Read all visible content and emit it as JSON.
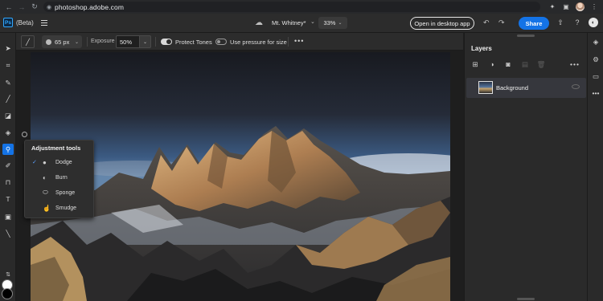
{
  "browser": {
    "url": "photoshop.adobe.com",
    "nav_icons": [
      "back-icon",
      "forward-icon",
      "reload-icon"
    ],
    "right_icons": [
      "extensions-icon",
      "sidebar-icon",
      "profile-avatar",
      "more-icon"
    ]
  },
  "header": {
    "logo": "Ps",
    "beta_label": "(Beta)",
    "doc_title": "Mt. Whitney*",
    "zoom": "33%",
    "open_desktop_label": "Open in desktop app",
    "share_label": "Share"
  },
  "tools": [
    {
      "name": "move-tool",
      "glyph": "➤",
      "active": false
    },
    {
      "name": "lasso-tool",
      "glyph": "⌗",
      "active": false
    },
    {
      "name": "quick-select-tool",
      "glyph": "✎",
      "active": false
    },
    {
      "name": "brush-tool",
      "glyph": "╱",
      "active": false
    },
    {
      "name": "eraser-tool",
      "glyph": "◪",
      "active": false
    },
    {
      "name": "paint-bucket-tool",
      "glyph": "◈",
      "active": false
    },
    {
      "name": "dodge-tool",
      "glyph": "⚲",
      "active": true
    },
    {
      "name": "healing-brush-tool",
      "glyph": "✐",
      "active": false
    },
    {
      "name": "crop-tool",
      "glyph": "⊓",
      "active": false
    },
    {
      "name": "type-tool",
      "glyph": "T",
      "active": false
    },
    {
      "name": "image-tool",
      "glyph": "▣",
      "active": false
    },
    {
      "name": "eyedropper-tool",
      "glyph": "╲",
      "active": false
    }
  ],
  "options": {
    "brush_size": "65 px",
    "exposure_label": "Exposure",
    "exposure_value": "50%",
    "protect_tones_label": "Protect Tones",
    "protect_tones_on": true,
    "pressure_label": "Use pressure for size",
    "pressure_on": false
  },
  "flyout": {
    "title": "Adjustment tools",
    "items": [
      {
        "label": "Dodge",
        "checked": true,
        "icon": "dodge-icon"
      },
      {
        "label": "Burn",
        "checked": false,
        "icon": "burn-icon"
      },
      {
        "label": "Sponge",
        "checked": false,
        "icon": "sponge-icon"
      },
      {
        "label": "Smudge",
        "checked": false,
        "icon": "smudge-icon"
      }
    ]
  },
  "layers": {
    "title": "Layers",
    "items": [
      {
        "name": "Background",
        "selected": true
      }
    ]
  },
  "colors": {
    "accent": "#1473e6",
    "foreground": "#ffffff",
    "background": "#000000"
  }
}
